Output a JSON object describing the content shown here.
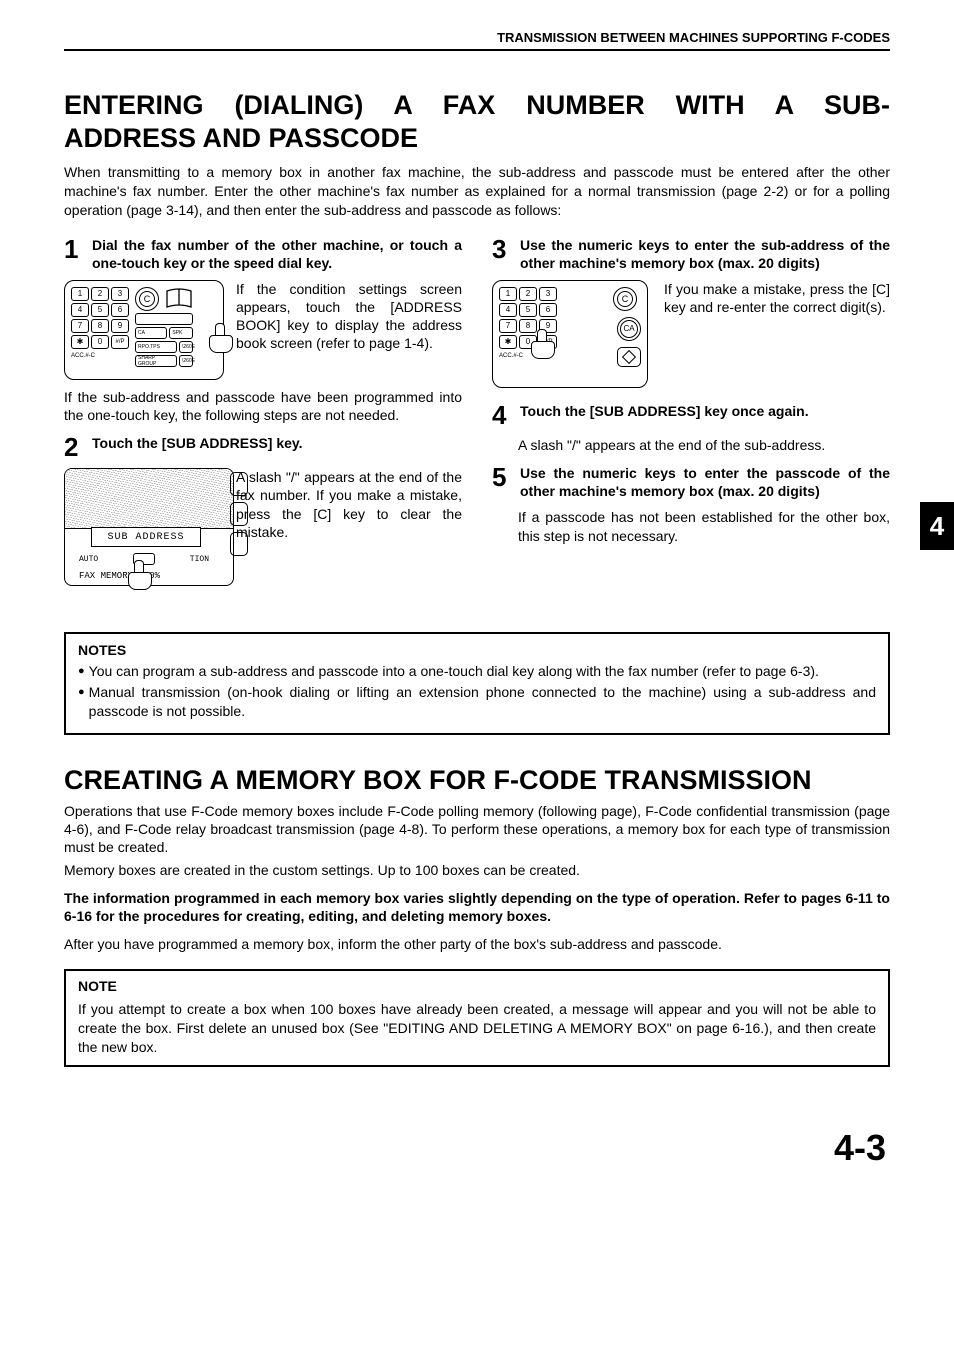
{
  "header": "TRANSMISSION BETWEEN MACHINES SUPPORTING F-CODES",
  "h1_line1": "ENTERING (DIALING) A FAX NUMBER WITH A SUB-",
  "h1_line2": "ADDRESS AND PASSCODE",
  "intro": "When transmitting to a memory box in another fax machine, the sub-address and passcode must be entered after the other machine's fax number. Enter the other machine's fax number as explained for a normal transmission (page 2-2) or for a polling operation (page 3-14), and then enter the sub-address and passcode as follows:",
  "step1": {
    "num": "1",
    "title": "Dial the fax number of the other machine, or touch a one-touch key or the speed dial key.",
    "side": "If the condition settings screen appears, touch the [ADDRESS BOOK] key to display the address book screen (refer to page 1-4).",
    "below": "If the sub-address and passcode have been programmed into the one-touch key, the following steps are not needed."
  },
  "step2": {
    "num": "2",
    "title": "Touch the [SUB ADDRESS] key.",
    "side": "A slash \"/\" appears at the end of the fax number. If you make a mistake, press the [C] key to clear the mistake."
  },
  "step3": {
    "num": "3",
    "title": "Use the numeric keys to enter the sub-address of the other machine's memory box (max. 20 digits)",
    "side": "If you make a mistake, press the [C] key and re-enter the correct digit(s)."
  },
  "step4": {
    "num": "4",
    "title": "Touch the [SUB ADDRESS] key once again.",
    "body": "A slash \"/\" appears at the end of the sub-address."
  },
  "step5": {
    "num": "5",
    "title": "Use the numeric keys to enter the passcode of the other machine's memory box (max. 20 digits)",
    "body": "If a passcode has not been established for the other box, this step is not necessary."
  },
  "keypad": {
    "rows": [
      [
        "1",
        "2",
        "3"
      ],
      [
        "4",
        "5",
        "6"
      ],
      [
        "7",
        "8",
        "9"
      ],
      [
        "✱",
        "0",
        "#/P"
      ]
    ],
    "acc": "ACC.#-C",
    "c_label": "C",
    "ca_label": "CA",
    "spk": "SPK",
    "slot1": "RPO.TPS",
    "slot2": "SHARP GROUP"
  },
  "touchscreen": {
    "sub_address": "SUB ADDRESS",
    "auto_left": "AUTO",
    "auto_right": "TION",
    "faxmem": "FAX MEMORY:100%"
  },
  "notes1": {
    "title": "NOTES",
    "items": [
      "You can program a sub-address and passcode into a one-touch dial key along with the fax number (refer to page 6-3).",
      "Manual transmission (on-hook dialing or lifting an extension phone connected to the machine) using a sub-address and passcode is not possible."
    ]
  },
  "h2": "CREATING A MEMORY BOX FOR F-CODE TRANSMISSION",
  "sec2_p1": "Operations that use F-Code memory boxes include F-Code polling memory (following page), F-Code confidential transmission (page 4-6), and F-Code relay broadcast transmission (page 4-8). To perform these operations, a memory box for each type of transmission must be created.",
  "sec2_p2": "Memory boxes are created in the custom settings. Up to 100 boxes can be created.",
  "sec2_bold": "The information programmed in each memory box varies slightly depending on the type of operation. Refer to pages 6-11 to 6-16 for the procedures for creating, editing, and deleting memory boxes.",
  "sec2_p3": "After you have programmed a memory box, inform the other party of the box's sub-address and passcode.",
  "note2": {
    "title": "NOTE",
    "body": "If you attempt to create a box when 100 boxes have already been created, a message will appear and you will not be able to create the box. First delete an unused box (See \"EDITING AND DELETING A MEMORY BOX\" on page 6-16.), and then create the new box."
  },
  "side_tab": "4",
  "page_number": "4-3"
}
